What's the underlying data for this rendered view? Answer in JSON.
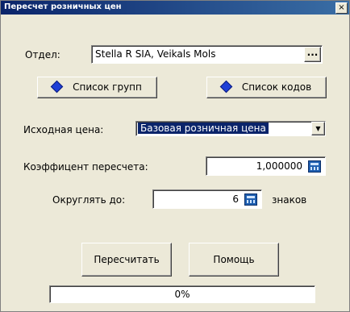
{
  "window": {
    "title": "Пересчет розничных цен",
    "close": "×"
  },
  "department": {
    "label": "Отдел:",
    "value": "Stella R SIA, Veikals Mols",
    "browse": "..."
  },
  "buttons": {
    "groups": "Список групп",
    "codes": "Список кодов",
    "recalc": "Пересчитать",
    "help": "Помощь"
  },
  "source_price": {
    "label": "Исходная цена:",
    "value": "Базовая розничная цена",
    "arrow": "▼"
  },
  "coefficient": {
    "label": "Коэффицент пересчета:",
    "value": "1,000000"
  },
  "rounding": {
    "label": "Округлять до:",
    "value": "6",
    "suffix": "знаков"
  },
  "progress": {
    "text": "0%",
    "percent": 0
  }
}
